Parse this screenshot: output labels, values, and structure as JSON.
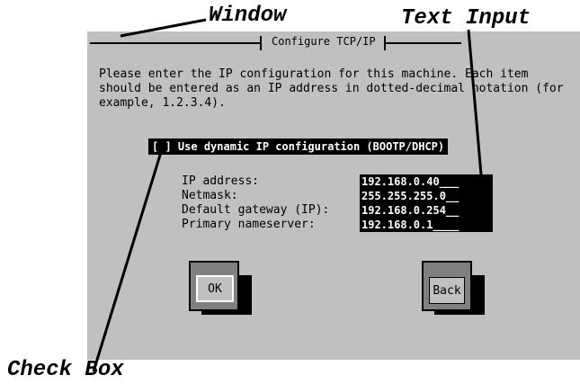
{
  "callouts": {
    "window": "Window",
    "text_input": "Text Input",
    "check_box": "Check Box"
  },
  "window": {
    "title": "Configure TCP/IP",
    "instructions": "Please enter the IP configuration for this machine. Each item should be entered as an IP address in dotted-decimal notation (for example, 1.2.3.4).",
    "dynamic_ip": {
      "box": "[ ]",
      "label": "Use dynamic IP configuration (BOOTP/DHCP)",
      "checked": false
    },
    "fields": [
      {
        "label": "IP address:",
        "value": "192.168.0.40___"
      },
      {
        "label": "Netmask:",
        "value": "255.255.255.0__"
      },
      {
        "label": "Default gateway (IP):",
        "value": "192.168.0.254__"
      },
      {
        "label": "Primary nameserver:",
        "value": "192.168.0.1____"
      }
    ],
    "buttons": {
      "ok": "OK",
      "back": "Back"
    }
  },
  "colors": {
    "window_bg": "#c0c0c0",
    "field_bg": "#000000",
    "field_fg": "#ffffff"
  }
}
